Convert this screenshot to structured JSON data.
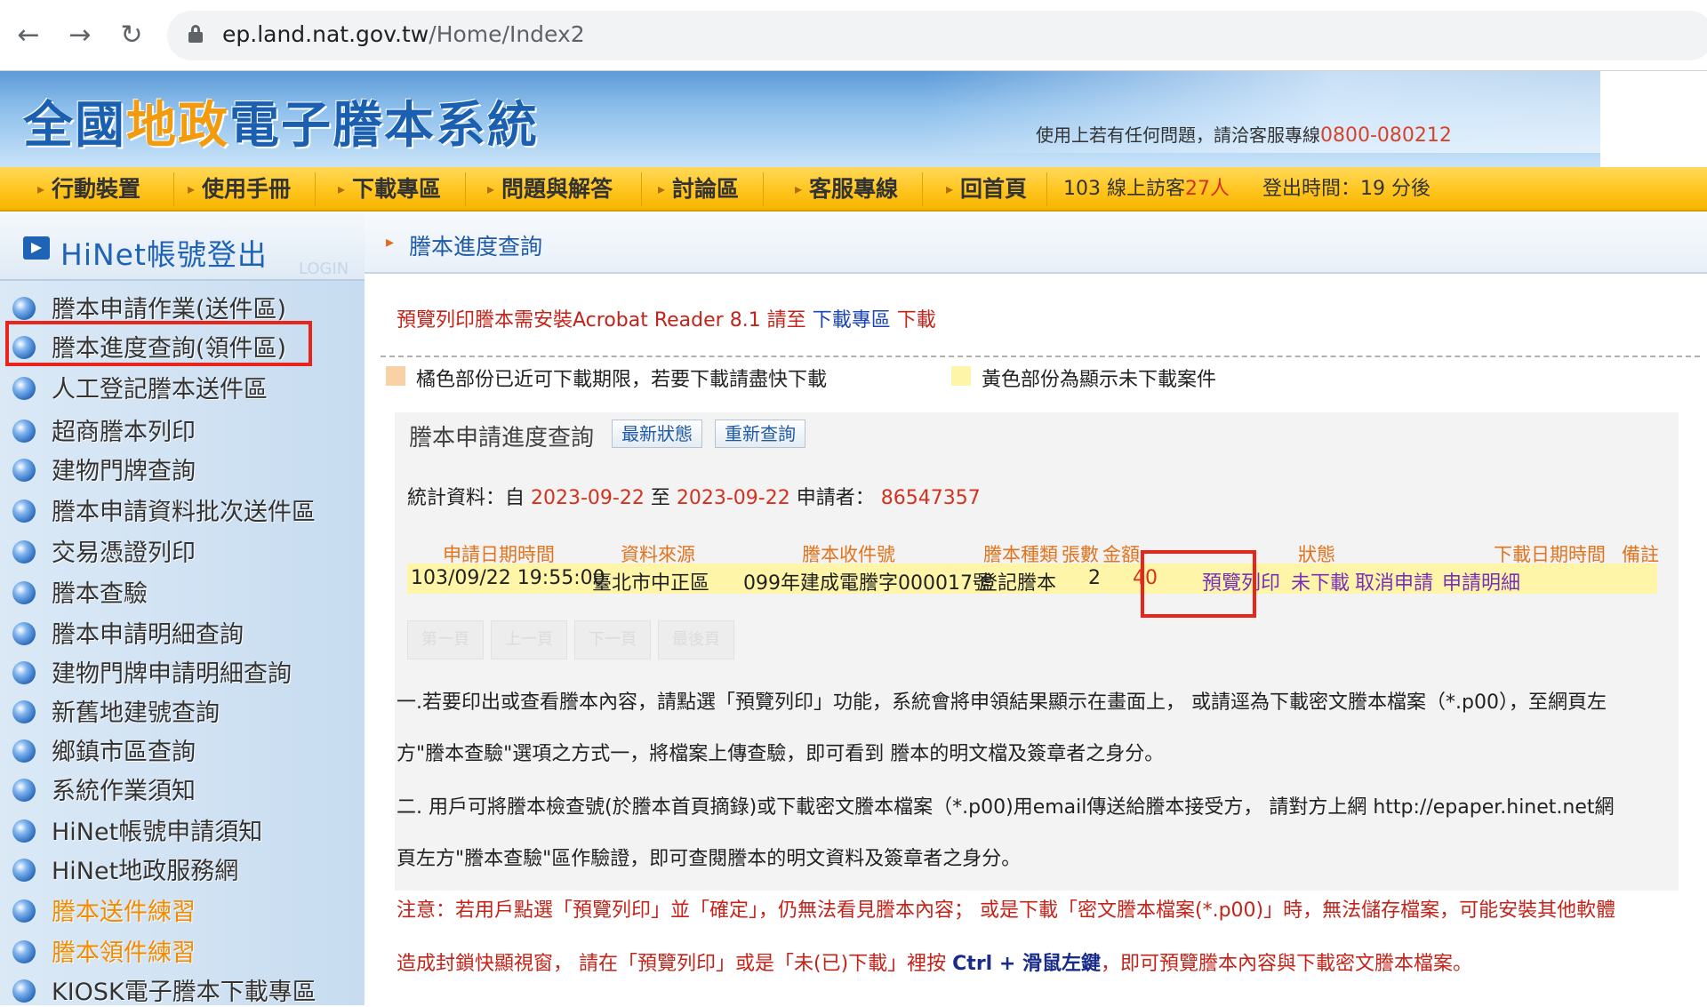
{
  "browser": {
    "url_host": "ep.land.nat.gov.tw",
    "url_path": "/Home/Index2"
  },
  "header": {
    "title_part1": "全國",
    "title_part2": "地政",
    "title_part3": "電子謄本系統",
    "support_text": "使用上若有任何問題，請洽客服專線",
    "support_phone": "0800-080212"
  },
  "menu": {
    "items": [
      {
        "label": "行動裝置"
      },
      {
        "label": "使用手冊"
      },
      {
        "label": "下載專區"
      },
      {
        "label": "問題與解答"
      },
      {
        "label": "討論區"
      },
      {
        "label": "客服專線"
      },
      {
        "label": "回首頁"
      }
    ],
    "online_prefix": "103  線上訪客",
    "online_count": "27人",
    "logout_text": "登出時間：19 分後"
  },
  "sidebar": {
    "login_label": "HiNet帳號登出",
    "login_ghost": "LOGIN",
    "items": [
      {
        "label": "謄本申請作業(送件區)"
      },
      {
        "label": "謄本進度查詢(領件區)"
      },
      {
        "label": "人工登記謄本送件區"
      },
      {
        "label": "超商謄本列印"
      },
      {
        "label": "建物門牌查詢"
      },
      {
        "label": "謄本申請資料批次送件區"
      },
      {
        "label": "交易憑證列印"
      },
      {
        "label": "謄本查驗"
      },
      {
        "label": "謄本申請明細查詢"
      },
      {
        "label": "建物門牌申請明細查詢"
      },
      {
        "label": "新舊地建號查詢"
      },
      {
        "label": "鄉鎮市區查詢"
      },
      {
        "label": "系統作業須知"
      },
      {
        "label": "HiNet帳號申請須知"
      },
      {
        "label": "HiNet地政服務網"
      },
      {
        "label": "謄本送件練習"
      },
      {
        "label": "謄本領件練習"
      },
      {
        "label": "KIOSK電子謄本下載專區"
      }
    ]
  },
  "main": {
    "breadcrumb": "謄本進度查詢",
    "notice_prefix": "預覽列印謄本需安裝Acrobat Reader 8.1 請至 ",
    "notice_link": "下載專區",
    "notice_suffix": " 下載",
    "legend_orange": "橘色部份已近可下載期限，若要下載請盡快下載",
    "legend_yellow": "黃色部份為顯示未下載案件",
    "colors": {
      "orange_swatch": "#f9d1a6",
      "yellow_swatch": "#fff5a8",
      "highlight": "#e8251b"
    },
    "panel": {
      "title": "謄本申請進度查詢",
      "btn_latest": "最新狀態",
      "btn_requery": "重新查詢"
    },
    "stats": {
      "label_from": "統計資料：自 ",
      "date_from": "2023-09-22",
      "label_to": " 至 ",
      "date_to": "2023-09-22",
      "label_applicant": " 申請者： ",
      "applicant": "86547357"
    },
    "table": {
      "headers": [
        "申請日期時間",
        "資料來源",
        "謄本收件號",
        "謄本種類",
        "張數",
        "金額",
        "狀態",
        "下載日期時間",
        "備註"
      ],
      "row": {
        "datetime": "103/09/22 19:55:00",
        "source": "臺北市中正區",
        "receipt_no": "099年建成電謄字000017號",
        "type": "登記謄本",
        "pages": "2",
        "amount": "40",
        "preview": "預覽列印",
        "status": "未下載",
        "cancel": "取消申請",
        "detail": "申請明細"
      }
    },
    "pager": [
      "第一頁",
      "上一頁",
      "下一頁",
      "最後頁"
    ],
    "paragraphs": {
      "p1a": "一.若要印出或查看謄本內容，請點選「預覽列印」功能，系統會將申領結果顯示在畫面上， 或請逕為下載密文謄本檔案（*.p00），至網頁左",
      "p1b": "方\"謄本查驗\"選項之方式一，將檔案上傳查驗，即可看到 謄本的明文檔及簽章者之身分。",
      "p2a": "二. 用戶可將謄本檢查號(於謄本首頁摘錄)或下載密文謄本檔案（*.p00)用email傳送給謄本接受方， 請對方上網 http://epaper.hinet.net網",
      "p2b": "頁左方\"謄本查驗\"區作驗證，即可查閱謄本的明文資料及簽章者之身分。",
      "p3a": "注意：若用戶點選「預覽列印」並「確定」，仍無法看見謄本內容； 或是下載「密文謄本檔案(*.p00)」時，無法儲存檔案，可能安裝其他軟體",
      "p3b_pre": "造成封鎖快顯視窗， 請在「預覽列印」或是「未(已)下載」裡按 ",
      "p3b_key": "Ctrl + 滑鼠左鍵",
      "p3b_post": "，即可預覽謄本內容與下載密文謄本檔案。"
    }
  }
}
